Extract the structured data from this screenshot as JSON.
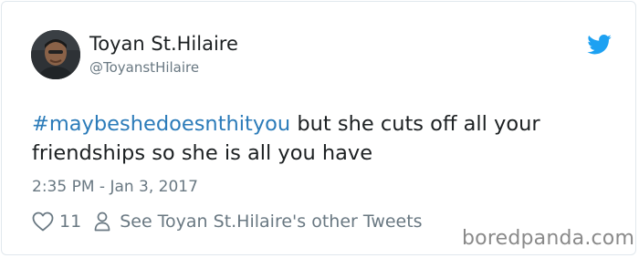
{
  "author": {
    "display_name": "Toyan St.Hilaire",
    "handle": "@ToyanstHilaire"
  },
  "tweet": {
    "hashtag": "#maybeshedoesnthityou",
    "text": " but she cuts off all your friendships so she is all you have",
    "timestamp": "2:35 PM - Jan 3, 2017"
  },
  "actions": {
    "like_count": "11",
    "other_tweets_label": "See Toyan St.Hilaire's other Tweets"
  },
  "icons": {
    "brand": "twitter-bird-icon",
    "like": "heart-icon",
    "profile": "person-icon"
  },
  "colors": {
    "hashtag": "#2b7bb9",
    "twitter_blue": "#1da1f2",
    "muted_text": "#697882",
    "main_text": "#1c2022",
    "border": "#e1e8ed"
  },
  "watermark": "boredpanda.com"
}
